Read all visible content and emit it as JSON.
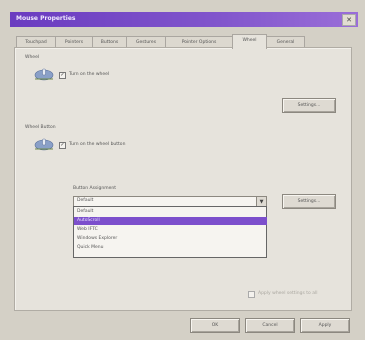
{
  "window": {
    "title": "Mouse Properties",
    "close_glyph": "✕"
  },
  "tabs": [
    {
      "label": "Touchpad"
    },
    {
      "label": "Pointers"
    },
    {
      "label": "Buttons"
    },
    {
      "label": "Gestures"
    },
    {
      "label": "Pointer Options"
    },
    {
      "label": "Wheel"
    },
    {
      "label": "General"
    }
  ],
  "wheel": {
    "group_label": "Wheel",
    "checkbox_label": "Turn on the wheel",
    "checked": true,
    "settings_label": "Settings..."
  },
  "wheel_button": {
    "group_label": "Wheel Button",
    "checkbox_label": "Turn on the wheel button",
    "checked": true,
    "assignment_label": "Button Assignment",
    "selected_value": "Default",
    "options": [
      "Default",
      "AutoScroll",
      "Web IFTC",
      "Windows Explorer",
      "Quick Menu"
    ],
    "highlighted_index": 1,
    "settings_label": "Settings..."
  },
  "footer_hint": "Apply wheel settings to all",
  "buttons": {
    "ok": "OK",
    "cancel": "Cancel",
    "apply": "Apply"
  },
  "icons": {
    "wheel_icon": "mouse-wheel-icon",
    "wheel_button_icon": "mouse-button-icon",
    "dropdown_arrow": "▼"
  }
}
